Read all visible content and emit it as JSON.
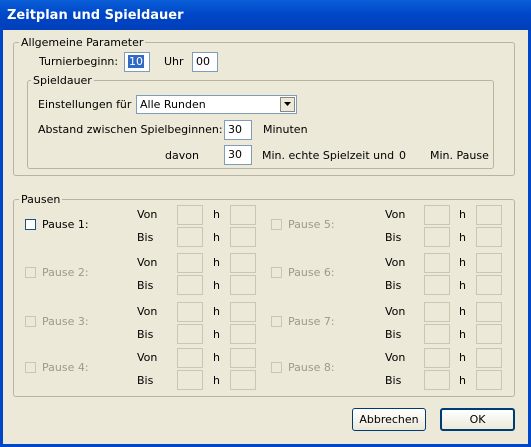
{
  "window": {
    "title": "Zeitplan und Spieldauer"
  },
  "allgemein": {
    "legend": "Allgemeine Parameter",
    "turnierbeginn_label": "Turnierbeginn:",
    "hour_value": "10",
    "uhr_label": "Uhr",
    "minute_value": "00"
  },
  "spieldauer": {
    "legend": "Spieldauer",
    "einstellungen_label": "Einstellungen für",
    "einstellungen_value": "Alle Runden",
    "abstand_label": "Abstand zwischen Spielbeginnen:",
    "abstand_value": "30",
    "minuten_label": "Minuten",
    "davon_label": "davon",
    "spielzeit_value": "30",
    "spielzeit_suffix": "Min. echte Spielzeit und",
    "pause_value": "0",
    "pause_suffix": "Min. Pause"
  },
  "pausen": {
    "legend": "Pausen",
    "von_label": "Von",
    "bis_label": "Bis",
    "h_label": "h",
    "items": [
      {
        "label": "Pause 1:",
        "enabled": true
      },
      {
        "label": "Pause 2:",
        "enabled": false
      },
      {
        "label": "Pause 3:",
        "enabled": false
      },
      {
        "label": "Pause 4:",
        "enabled": false
      },
      {
        "label": "Pause 5:",
        "enabled": false
      },
      {
        "label": "Pause 6:",
        "enabled": false
      },
      {
        "label": "Pause 7:",
        "enabled": false
      },
      {
        "label": "Pause 8:",
        "enabled": false
      }
    ]
  },
  "buttons": {
    "cancel": "Abbrechen",
    "ok": "OK"
  }
}
